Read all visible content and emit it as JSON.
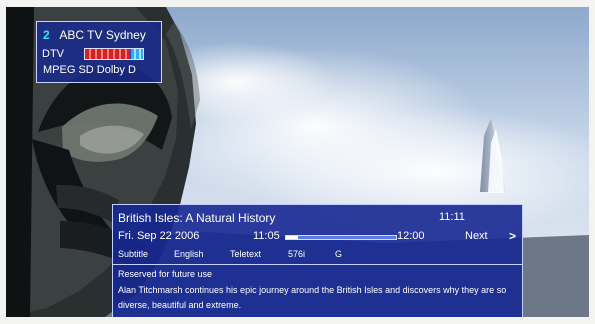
{
  "screen": {
    "channel": {
      "number": "2",
      "name": "ABC TV Sydney",
      "type": "DTV",
      "format": "MPEG SD Dolby D",
      "signal_level": 0.78
    },
    "program": {
      "title": "British Isles: A Natural History",
      "current_time": "11:11",
      "date": "Fri. Sep 22 2006",
      "start_time": "11:05",
      "end_time": "12:00",
      "progress": 0.11,
      "next_label": "Next",
      "next_icon": ">",
      "subtitle_label": "Subtitle",
      "language": "English",
      "teletext_label": "Teletext",
      "resolution": "576i",
      "rating": "G",
      "description_line_1": "Reserved for future use",
      "description_line_2": "Alan Titchmarsh continues his epic journey around the British Isles and discovers why they are so diverse, beautiful and extreme."
    }
  },
  "colors": {
    "overlay": "#1F2E91",
    "accent": "#2DE4FF",
    "signal_red": "#D42121"
  }
}
